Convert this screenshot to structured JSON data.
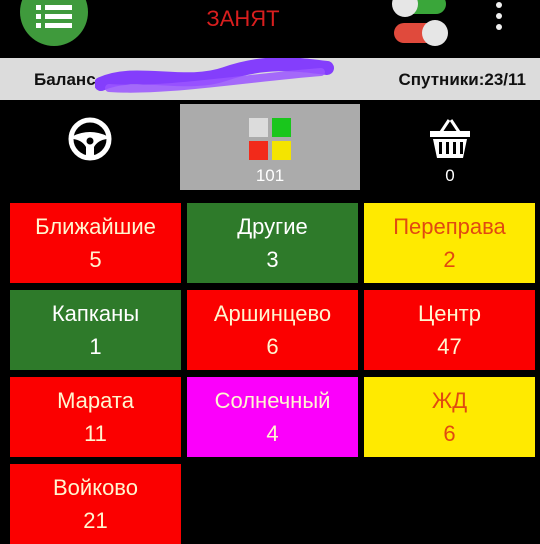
{
  "header": {
    "status_title": "ЗАНЯТ",
    "menu_icon": "menu-list-icon",
    "toggle_top": {
      "state": "on",
      "color": "#3aa63a"
    },
    "toggle_bottom": {
      "state": "on",
      "color": "#e04a3c"
    }
  },
  "info": {
    "balance_label": "Баланс",
    "satellites": "Спутники:23/11"
  },
  "tabs": [
    {
      "icon": "steering-wheel-icon",
      "count": "",
      "active": false
    },
    {
      "icon": "color-squares-icon",
      "count": "101",
      "active": true
    },
    {
      "icon": "basket-icon",
      "count": "0",
      "active": false
    }
  ],
  "colors": {
    "red": "#fb0000",
    "green": "#2e7a2a",
    "yellow": "#ffea00",
    "magenta": "#fb00fb",
    "accent_status": "#d81e1e"
  },
  "zones": [
    {
      "name": "Ближайшие",
      "count": "5",
      "color": "red"
    },
    {
      "name": "Другие",
      "count": "3",
      "color": "green"
    },
    {
      "name": "Переправа",
      "count": "2",
      "color": "yellow"
    },
    {
      "name": "Капканы",
      "count": "1",
      "color": "green"
    },
    {
      "name": "Аршинцево",
      "count": "6",
      "color": "red"
    },
    {
      "name": "Центр",
      "count": "47",
      "color": "red"
    },
    {
      "name": "Марата",
      "count": "11",
      "color": "red"
    },
    {
      "name": "Солнечный",
      "count": "4",
      "color": "magenta"
    },
    {
      "name": "ЖД",
      "count": "6",
      "color": "yellow"
    },
    {
      "name": "Войково",
      "count": "21",
      "color": "red"
    }
  ]
}
